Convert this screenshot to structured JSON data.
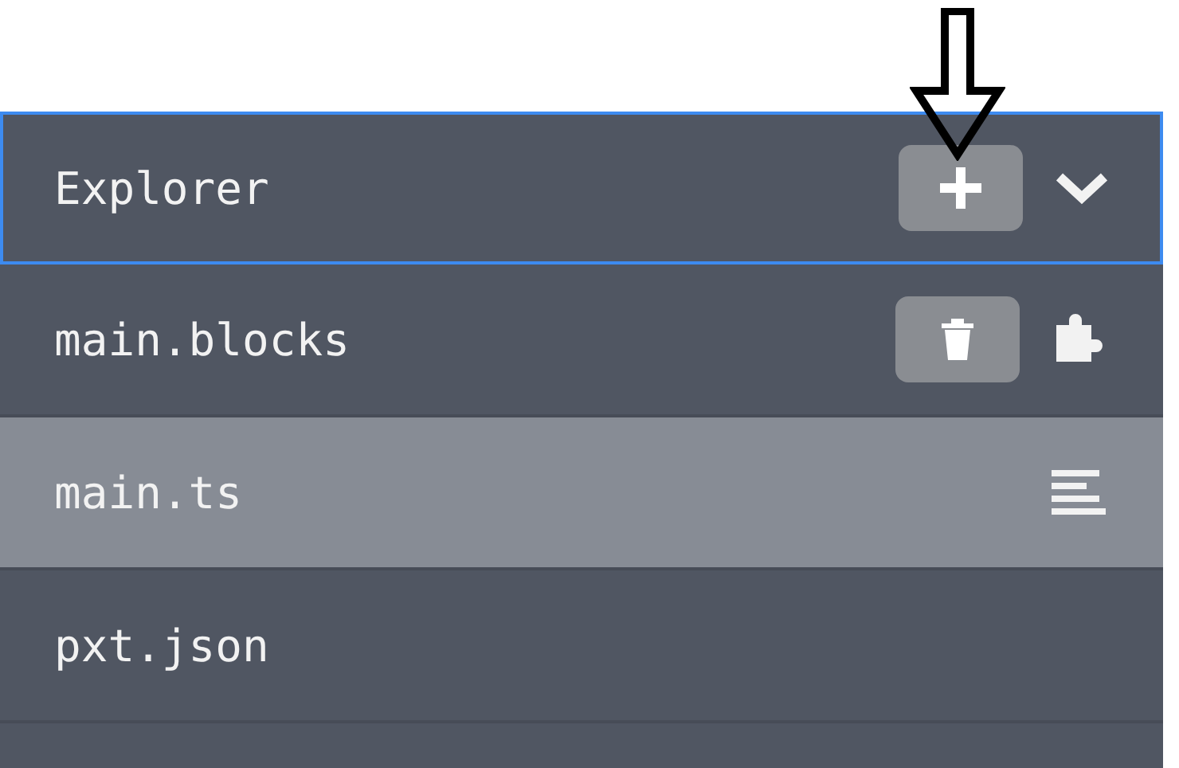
{
  "explorer": {
    "title": "Explorer",
    "expanded": true
  },
  "files": [
    {
      "name": "main.blocks",
      "selected": false,
      "kind": "blocks",
      "deletable": true
    },
    {
      "name": "main.ts",
      "selected": true,
      "kind": "text",
      "deletable": false
    },
    {
      "name": "pxt.json",
      "selected": false,
      "kind": "none",
      "deletable": false
    }
  ]
}
